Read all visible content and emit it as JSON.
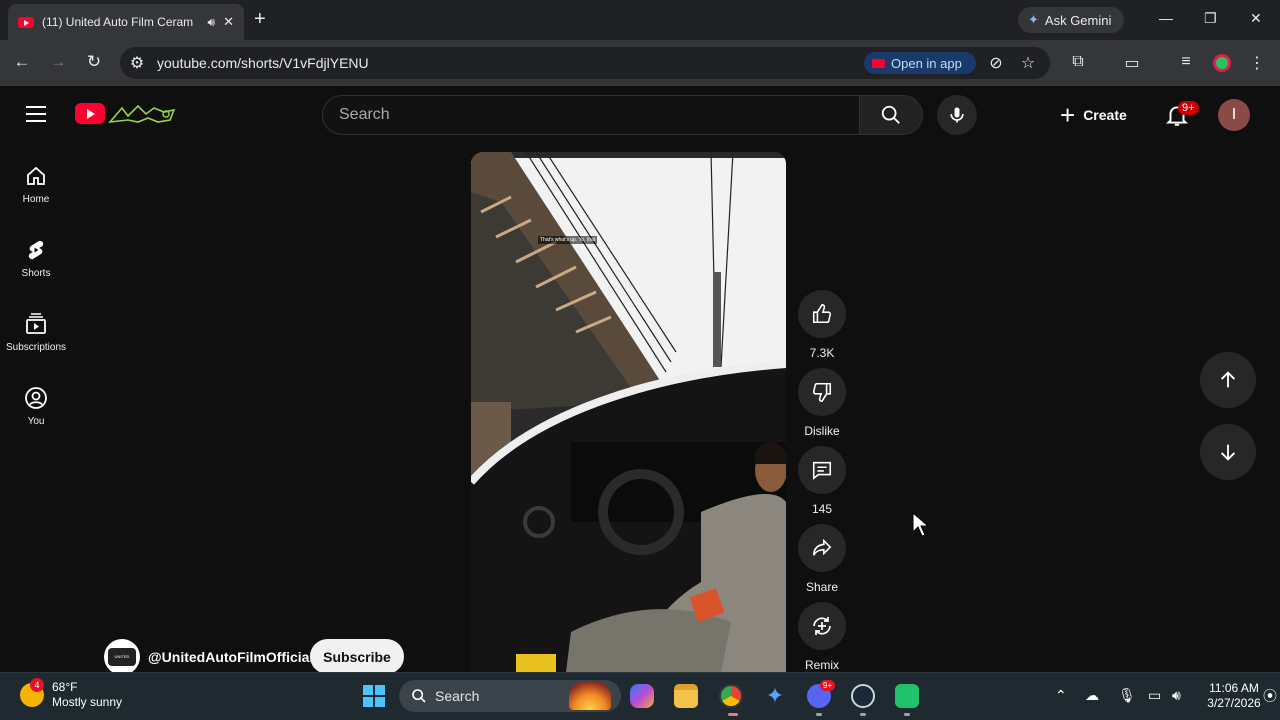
{
  "browser": {
    "tab_title": "(11) United Auto Film Ceram",
    "new_tab": "+",
    "ask_gemini": "Ask Gemini",
    "window_controls": {
      "minimize": "—",
      "restore": "❐",
      "close": "✕"
    },
    "url": "youtube.com/shorts/V1vFdjlYENU",
    "open_in_app": "Open in app"
  },
  "youtube": {
    "search_placeholder": "Search",
    "create_label": "Create",
    "notifications_badge": "9+",
    "avatar_initial": "I"
  },
  "sidebar": {
    "items": [
      {
        "label": "Home",
        "icon": "home-icon"
      },
      {
        "label": "Shorts",
        "icon": "shorts-icon"
      },
      {
        "label": "Subscriptions",
        "icon": "subscriptions-icon"
      },
      {
        "label": "You",
        "icon": "you-icon"
      }
    ]
  },
  "video": {
    "overlay_caption": "That's what's up. Yo, that"
  },
  "actions": {
    "like_count": "7.3K",
    "dislike_label": "Dislike",
    "comment_count": "145",
    "share_label": "Share",
    "remix_label": "Remix"
  },
  "channel": {
    "handle": "@UnitedAutoFilmOfficial",
    "subscribe_label": "Subscribe",
    "avatar_text": "UNITED"
  },
  "taskbar": {
    "weather_temp": "68°F",
    "weather_desc": "Mostly sunny",
    "weather_badge": "4",
    "search_label": "Search",
    "discord_badge": "9+",
    "time": "11:06 AM",
    "date": "3/27/2026"
  },
  "colors": {
    "youtube_red": "#ff0033",
    "page_bg": "#0f0f0f",
    "chrome_bar": "#35363a",
    "taskbar": "#1f2a30"
  }
}
